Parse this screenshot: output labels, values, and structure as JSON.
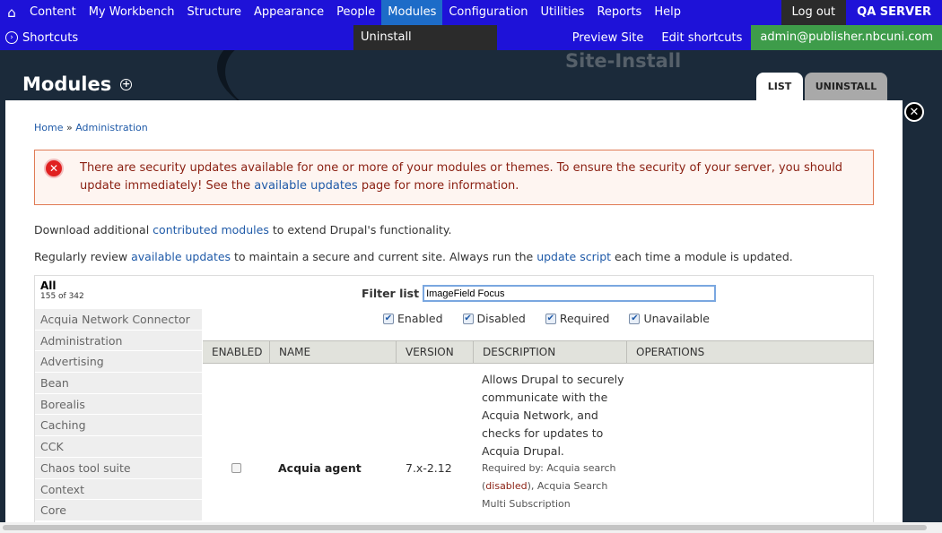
{
  "toolbar": {
    "home_icon": "home-icon",
    "items": [
      "Content",
      "My Workbench",
      "Structure",
      "Appearance",
      "People",
      "Modules",
      "Configuration",
      "Utilities",
      "Reports",
      "Help"
    ],
    "active_item": "Modules",
    "logout": "Log out",
    "server": "QA SERVER"
  },
  "shortcuts": {
    "toggle_label": "Shortcuts",
    "submenu_item": "Uninstall",
    "preview": "Preview Site",
    "edit": "Edit shortcuts",
    "user": "admin@publisher.nbcuni.com"
  },
  "header": {
    "background_text": "Site-Install",
    "title": "Modules",
    "tabs": [
      "LIST",
      "UNINSTALL"
    ]
  },
  "breadcrumb": {
    "home": "Home",
    "sep": "»",
    "admin": "Administration"
  },
  "alert": {
    "text_before": "There are security updates available for one or more of your modules or themes. To ensure the security of your server, you should update immediately! See the ",
    "link": "available updates",
    "text_after": " page for more information."
  },
  "intro": {
    "p1_before": "Download additional ",
    "p1_link": "contributed modules",
    "p1_after": " to extend Drupal's functionality.",
    "p2_before": "Regularly review ",
    "p2_link1": "available updates",
    "p2_middle": " to maintain a secure and current site. Always run the ",
    "p2_link2": "update script",
    "p2_after": " each time a module is updated."
  },
  "vtabs": {
    "all_label": "All",
    "all_count": "155 of 342",
    "items": [
      "Acquia Network Connector",
      "Administration",
      "Advertising",
      "Bean",
      "Borealis",
      "Caching",
      "CCK",
      "Chaos tool suite",
      "Context",
      "Core"
    ]
  },
  "filter": {
    "label": "Filter list",
    "value": "ImageField Focus",
    "checks": [
      "Enabled",
      "Disabled",
      "Required",
      "Unavailable"
    ]
  },
  "table": {
    "headers": [
      "ENABLED",
      "NAME",
      "VERSION",
      "DESCRIPTION",
      "OPERATIONS"
    ],
    "row": {
      "name": "Acquia agent",
      "version": "7.x-2.12",
      "description": "Allows Drupal to securely communicate with the Acquia Network, and checks for updates to Acquia Drupal.",
      "required_before": "Required by: Acquia search (",
      "required_disabled": "disabled",
      "required_after": "), Acquia Search Multi Subscription"
    }
  },
  "colors": {
    "toolbar": "#1e12d8",
    "active": "#1d6cc8",
    "user": "#3e9c4a",
    "header": "#1b2a3a",
    "alert_text": "#8a1f11",
    "link": "#1f5aa8"
  }
}
